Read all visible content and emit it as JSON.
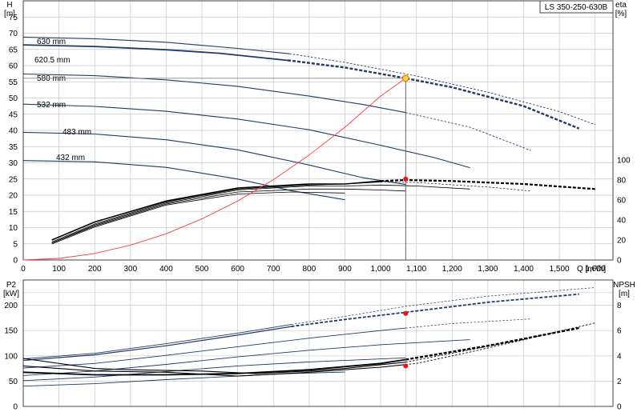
{
  "chart_data": {
    "type": "line",
    "model_label": "LS 350-250-630B",
    "x_axis": {
      "label": "Q [m³/h]",
      "ticks": [
        0,
        100,
        200,
        300,
        400,
        500,
        600,
        700,
        800,
        900,
        1000,
        1100,
        1200,
        1300,
        1400,
        1500,
        1600
      ],
      "tick_labels": [
        "0",
        "100",
        "200",
        "300",
        "400",
        "500",
        "600",
        "700",
        "800",
        "900",
        "1,000",
        "1,100",
        "1,200",
        "1,300",
        "1,400",
        "1,500",
        "1,600"
      ],
      "range": [
        0,
        1650
      ]
    },
    "head_panel": {
      "y_label_line1": "H",
      "y_label_line2": "[m]",
      "y_ticks": [
        0,
        5,
        10,
        15,
        20,
        25,
        30,
        35,
        40,
        45,
        50,
        55,
        60,
        65,
        70,
        75
      ],
      "y_range": [
        0,
        80
      ],
      "eta_label_line1": "eta",
      "eta_label_line2": "[%]",
      "eta_ticks": [
        0,
        20,
        40,
        60,
        80,
        100
      ],
      "eta_range": [
        0,
        100
      ],
      "impeller_curves": [
        {
          "label": "630 mm",
          "points": [
            [
              0,
              68.8
            ],
            [
              200,
              68.3
            ],
            [
              400,
              67.2
            ],
            [
              600,
              65.3
            ],
            [
              750,
              63.6
            ],
            [
              900,
              61
            ],
            [
              1100,
              56.8
            ],
            [
              1300,
              51.8
            ],
            [
              1500,
              45.8
            ],
            [
              1600,
              41.8
            ]
          ],
          "solid_until": 745
        },
        {
          "label": "620.5 mm",
          "points": [
            [
              0,
              66.4
            ],
            [
              200,
              65.9
            ],
            [
              400,
              64.9
            ],
            [
              550,
              63.8
            ],
            [
              750,
              61.5
            ],
            [
              900,
              59.4
            ],
            [
              1070,
              56.1
            ],
            [
              1200,
              53.3
            ],
            [
              1400,
              47.5
            ],
            [
              1555,
              40.6
            ]
          ],
          "solid_until": 740
        },
        {
          "label": "580 mm",
          "points": [
            [
              0,
              57.4
            ],
            [
              200,
              56.9
            ],
            [
              400,
              55.6
            ],
            [
              600,
              53.6
            ],
            [
              800,
              50.6
            ],
            [
              950,
              48
            ],
            [
              1070,
              45.5
            ],
            [
              1250,
              41
            ],
            [
              1420,
              33.8
            ]
          ],
          "solid_until": 1070
        },
        {
          "label": "532 mm",
          "points": [
            [
              0,
              48.1
            ],
            [
              200,
              47.4
            ],
            [
              400,
              45.9
            ],
            [
              600,
              43.5
            ],
            [
              800,
              40.2
            ],
            [
              1000,
              35.4
            ],
            [
              1150,
              31.6
            ],
            [
              1250,
              28.5
            ]
          ],
          "solid_until": 1250
        },
        {
          "label": "483 mm",
          "points": [
            [
              0,
              39.4
            ],
            [
              200,
              38.9
            ],
            [
              400,
              37.1
            ],
            [
              600,
              34
            ],
            [
              800,
              29.3
            ],
            [
              950,
              25.4
            ],
            [
              1070,
              23.3
            ]
          ],
          "solid_until": 1070
        },
        {
          "label": "432 mm",
          "points": [
            [
              0,
              30.7
            ],
            [
              200,
              30.3
            ],
            [
              400,
              28.6
            ],
            [
              600,
              25
            ],
            [
              750,
              21.4
            ],
            [
              900,
              18.6
            ]
          ],
          "solid_until": 900
        }
      ],
      "efficiency_curves": [
        {
          "points": [
            [
              80,
              20
            ],
            [
              200,
              38
            ],
            [
              400,
              59
            ],
            [
              600,
              72
            ],
            [
              800,
              76
            ],
            [
              900,
              76
            ],
            [
              1000,
              79
            ],
            [
              1070,
              80
            ],
            [
              1200,
              79
            ],
            [
              1400,
              76
            ],
            [
              1600,
              71
            ]
          ],
          "solid_until": 1000
        },
        {
          "points": [
            [
              80,
              18
            ],
            [
              200,
              36
            ],
            [
              400,
              58
            ],
            [
              600,
              71
            ],
            [
              800,
              75
            ],
            [
              900,
              76
            ],
            [
              1000,
              78
            ],
            [
              1100,
              77.5
            ],
            [
              1300,
              73
            ],
            [
              1420,
              69
            ]
          ],
          "solid_until": 1000
        },
        {
          "points": [
            [
              80,
              17
            ],
            [
              200,
              35
            ],
            [
              400,
              57
            ],
            [
              600,
              70
            ],
            [
              800,
              74
            ],
            [
              900,
              74
            ],
            [
              1000,
              75
            ],
            [
              1100,
              74
            ],
            [
              1250,
              71
            ]
          ],
          "solid_until": 1250
        },
        {
          "points": [
            [
              80,
              17
            ],
            [
              200,
              34
            ],
            [
              400,
              56
            ],
            [
              600,
              68
            ],
            [
              800,
              71
            ],
            [
              900,
              71
            ],
            [
              1000,
              70
            ],
            [
              1070,
              69
            ]
          ],
          "solid_until": 1070
        },
        {
          "points": [
            [
              80,
              16
            ],
            [
              200,
              33
            ],
            [
              400,
              55
            ],
            [
              600,
              66
            ],
            [
              750,
              68
            ],
            [
              900,
              67
            ]
          ],
          "solid_until": 900
        }
      ],
      "system_curve": [
        [
          0,
          0
        ],
        [
          100,
          0.5
        ],
        [
          200,
          2
        ],
        [
          300,
          4.6
        ],
        [
          400,
          8.1
        ],
        [
          500,
          12.7
        ],
        [
          600,
          18.2
        ],
        [
          700,
          24.8
        ],
        [
          800,
          32.4
        ],
        [
          900,
          41
        ],
        [
          1000,
          50.6
        ],
        [
          1070,
          56.1
        ]
      ],
      "duty_point": {
        "q": 1070,
        "h": 56.1
      },
      "duty_efficiency": {
        "q": 1070,
        "eta": 81
      }
    },
    "power_panel": {
      "y_label_line1": "P2",
      "y_label_line2": "[kW]",
      "y_ticks": [
        0,
        50,
        100,
        150,
        200
      ],
      "y_range": [
        0,
        250
      ],
      "npsh_label_line1": "NPSH",
      "npsh_label_line2": "[m]",
      "npsh_ticks": [
        0,
        2,
        4,
        6,
        8
      ],
      "npsh_range": [
        0,
        10
      ],
      "power_curves": [
        {
          "points": [
            [
              0,
              94
            ],
            [
              200,
              105
            ],
            [
              400,
              124
            ],
            [
              600,
              145
            ],
            [
              750,
              162
            ],
            [
              900,
              178
            ],
            [
              1070,
              198
            ],
            [
              1300,
              218
            ],
            [
              1600,
              235
            ]
          ],
          "solid_until": 750
        },
        {
          "points": [
            [
              0,
              91
            ],
            [
              200,
              102
            ],
            [
              400,
              120
            ],
            [
              600,
              141
            ],
            [
              750,
              158
            ],
            [
              900,
              172
            ],
            [
              1070,
              186
            ],
            [
              1300,
              206
            ],
            [
              1555,
              222
            ]
          ],
          "solid_until": 750
        },
        {
          "points": [
            [
              0,
              76
            ],
            [
              200,
              85
            ],
            [
              400,
              101
            ],
            [
              600,
              118
            ],
            [
              800,
              135
            ],
            [
              1000,
              150
            ],
            [
              1200,
              164
            ],
            [
              1420,
              173
            ]
          ],
          "solid_until": 1070
        },
        {
          "points": [
            [
              0,
              61
            ],
            [
              200,
              70
            ],
            [
              400,
              83
            ],
            [
              600,
              98
            ],
            [
              800,
              111
            ],
            [
              1000,
              122
            ],
            [
              1250,
              132
            ]
          ],
          "solid_until": 1250
        },
        {
          "points": [
            [
              0,
              51
            ],
            [
              200,
              58
            ],
            [
              400,
              69
            ],
            [
              600,
              80
            ],
            [
              800,
              88
            ],
            [
              1070,
              96
            ]
          ],
          "solid_until": 1070
        },
        {
          "points": [
            [
              0,
              40
            ],
            [
              200,
              45
            ],
            [
              400,
              53
            ],
            [
              600,
              60
            ],
            [
              750,
              65
            ],
            [
              900,
              68
            ]
          ],
          "solid_until": 900
        }
      ],
      "npsh_curves": [
        {
          "points": [
            [
              0,
              3.8
            ],
            [
              200,
              3
            ],
            [
              300,
              2.9
            ],
            [
              500,
              2.8
            ],
            [
              650,
              2.6
            ],
            [
              800,
              2.8
            ],
            [
              900,
              3
            ],
            [
              1070,
              3.5
            ],
            [
              1200,
              4.2
            ],
            [
              1400,
              5.3
            ],
            [
              1600,
              6.6
            ]
          ],
          "solid_until": 1070
        },
        {
          "points": [
            [
              0,
              3.2
            ],
            [
              200,
              2.8
            ],
            [
              400,
              2.7
            ],
            [
              600,
              2.4
            ],
            [
              800,
              2.7
            ],
            [
              1000,
              3.1
            ],
            [
              1100,
              3.4
            ],
            [
              1250,
              4.3
            ],
            [
              1420,
              5.4
            ]
          ],
          "solid_until": 1070
        },
        {
          "points": [
            [
              0,
              2.7
            ],
            [
              200,
              2.5
            ],
            [
              400,
              2.5
            ],
            [
              600,
              2.6
            ],
            [
              800,
              2.9
            ],
            [
              1000,
              3.4
            ],
            [
              1070,
              3.7
            ],
            [
              1300,
              4.8
            ],
            [
              1555,
              6.2
            ]
          ],
          "solid_until": 1070
        }
      ],
      "duty_power": {
        "q": 1070,
        "p2": 184
      },
      "duty_npsh": {
        "q": 1070,
        "npsh": 3.2
      }
    }
  },
  "colors": {
    "curve_blue": "#1f3b66",
    "curve_black": "#000000",
    "system_red": "#ff3b3b",
    "duty_marker_fill": "#ffd23f",
    "duty_marker_stroke": "#e07000",
    "point_red": "#ee1111",
    "grid": "#c8c8c8"
  }
}
